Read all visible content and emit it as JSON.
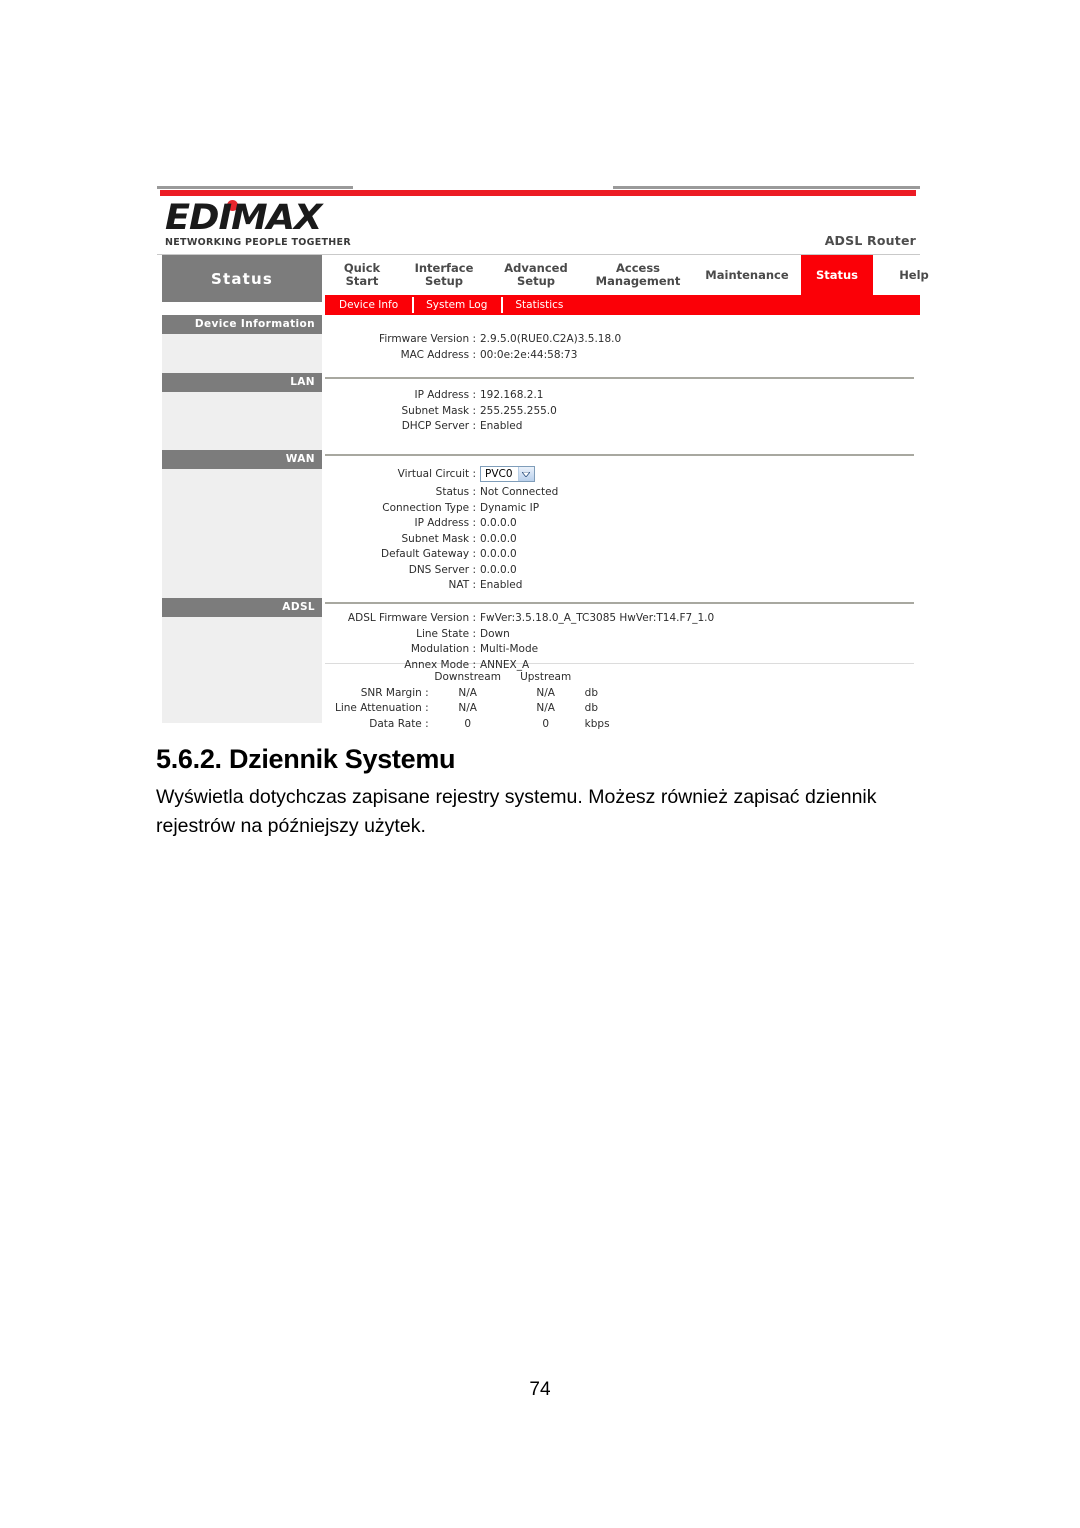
{
  "router_ui": {
    "brand": {
      "logo_text": "EDIMAX",
      "logo_tagline": "NETWORKING PEOPLE TOGETHER",
      "model": "ADSL Router"
    },
    "panel_title": "Status",
    "main_tabs": [
      {
        "label": "Quick\nStart",
        "active": false
      },
      {
        "label": "Interface\nSetup",
        "active": false
      },
      {
        "label": "Advanced\nSetup",
        "active": false
      },
      {
        "label": "Access\nManagement",
        "active": false
      },
      {
        "label": "Maintenance",
        "active": false
      },
      {
        "label": "Status",
        "active": true
      },
      {
        "label": "Help",
        "active": false
      }
    ],
    "sub_tabs": [
      {
        "label": "Device Info",
        "active": true
      },
      {
        "label": "System Log",
        "active": false
      },
      {
        "label": "Statistics",
        "active": false
      }
    ],
    "sections": {
      "device_information": {
        "header": "Device Information",
        "rows": [
          {
            "key": "Firmware Version :",
            "value": "2.9.5.0(RUE0.C2A)3.5.18.0"
          },
          {
            "key": "MAC Address :",
            "value": "00:0e:2e:44:58:73"
          }
        ]
      },
      "lan": {
        "header": "LAN",
        "rows": [
          {
            "key": "IP Address :",
            "value": "192.168.2.1"
          },
          {
            "key": "Subnet Mask :",
            "value": "255.255.255.0"
          },
          {
            "key": "DHCP Server :",
            "value": "Enabled"
          }
        ]
      },
      "wan": {
        "header": "WAN",
        "virtual_circuit_label": "Virtual Circuit :",
        "virtual_circuit_value": "PVC0",
        "rows": [
          {
            "key": "Status :",
            "value": "Not Connected"
          },
          {
            "key": "Connection Type :",
            "value": "Dynamic IP"
          },
          {
            "key": "IP Address :",
            "value": "0.0.0.0"
          },
          {
            "key": "Subnet Mask :",
            "value": "0.0.0.0"
          },
          {
            "key": "Default Gateway :",
            "value": "0.0.0.0"
          },
          {
            "key": "DNS Server :",
            "value": "0.0.0.0"
          },
          {
            "key": "NAT :",
            "value": "Enabled"
          }
        ]
      },
      "adsl": {
        "header": "ADSL",
        "rows": [
          {
            "key": "ADSL Firmware Version :",
            "value": "FwVer:3.5.18.0_A_TC3085 HwVer:T14.F7_1.0"
          },
          {
            "key": "Line State :",
            "value": "Down"
          },
          {
            "key": "Modulation :",
            "value": "Multi-Mode"
          },
          {
            "key": "Annex Mode :",
            "value": "ANNEX_A"
          }
        ],
        "stats": {
          "col_downstream": "Downstream",
          "col_upstream": "Upstream",
          "rows": [
            {
              "label": "SNR Margin :",
              "downstream": "N/A",
              "upstream": "N/A",
              "unit": "db"
            },
            {
              "label": "Line Attenuation :",
              "downstream": "N/A",
              "upstream": "N/A",
              "unit": "db"
            },
            {
              "label": "Data Rate :",
              "downstream": "0",
              "upstream": "0",
              "unit": "kbps"
            }
          ]
        }
      }
    },
    "colors": {
      "accent_red": "#fb0007",
      "header_gray": "#7c7c7c",
      "fill_gray": "#efefef"
    }
  },
  "document": {
    "heading": "5.6.2. Dziennik Systemu",
    "paragraph": "Wyświetla dotychczas zapisane rejestry systemu. Możesz również zapisać dziennik rejestrów na późniejszy użytek.",
    "page_number": "74"
  }
}
